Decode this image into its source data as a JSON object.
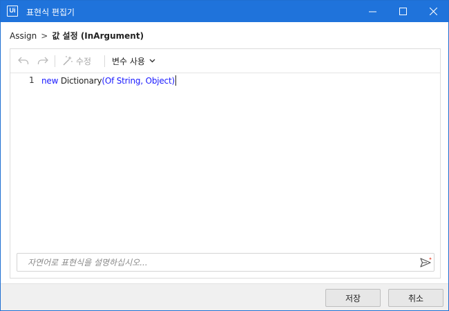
{
  "window": {
    "title": "표현식 편집기",
    "logo_text": "Ui",
    "accent_color": "#1f73db",
    "controls": [
      "minimize-icon",
      "maximize-icon",
      "close-icon"
    ]
  },
  "breadcrumb": {
    "root": "Assign",
    "separator": ">",
    "current": "값 설정 (InArgument)"
  },
  "toolbar": {
    "undo_icon": "undo-icon",
    "redo_icon": "redo-icon",
    "fix_label": "수정",
    "fix_icon": "magic-wand-icon",
    "variables_label": "변수 사용",
    "variables_icon": "chevron-down-icon"
  },
  "editor": {
    "line_number": "1",
    "code": {
      "keyword": "new",
      "type": " Dictionary",
      "generic": "(Of String, Object)"
    }
  },
  "prompt": {
    "placeholder": "자연어로 표현식을 설명하십시오...",
    "value": "",
    "send_icon": "send-sparkle-icon"
  },
  "footer": {
    "save_label": "저장",
    "cancel_label": "취소"
  }
}
